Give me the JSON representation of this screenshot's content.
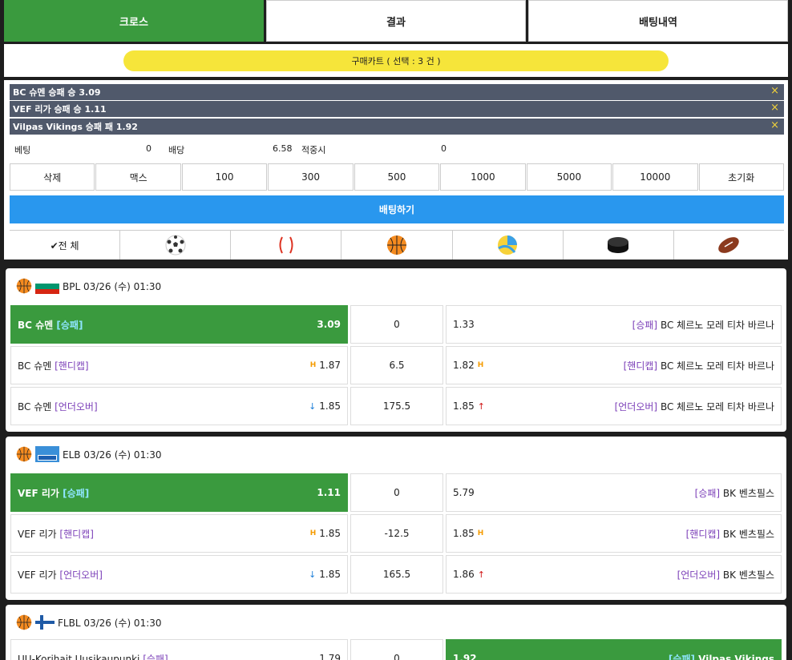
{
  "tabs": [
    "크로스",
    "결과",
    "배팅내역"
  ],
  "cart": {
    "label": "구매카트 ( 선택 : 3 건 )"
  },
  "selections": [
    {
      "text": "BC 슈멘 승패 승 3.09",
      "close": "×"
    },
    {
      "text": "VEF 리가 승패 승 1.11",
      "close": "×"
    },
    {
      "text": "Vilpas Vikings 승패 패 1.92",
      "close": "×"
    }
  ],
  "betinfo": {
    "bet_label": "베팅",
    "bet_value": "0",
    "odds_label": "배당",
    "odds_value": "6.58",
    "win_label": "적중시",
    "win_value": "0"
  },
  "amount_buttons": [
    "삭제",
    "맥스",
    "100",
    "300",
    "500",
    "1000",
    "5000",
    "10000",
    "초기화"
  ],
  "bet_button": "배팅하기",
  "sports": {
    "all_label": "✔전 체",
    "icons": [
      "soccer-ball-icon",
      "baseball-icon",
      "basketball-icon",
      "volleyball-icon",
      "hockey-puck-icon",
      "football-icon"
    ]
  },
  "colors": {
    "green": "#3a9a3e",
    "blue": "#2997ee",
    "cart_yellow": "#f6e53a",
    "slip_bg": "#50596b",
    "tag_purple": "#7b3fb8"
  },
  "games": [
    {
      "league": "BPL 03/26 (수) 01:30",
      "flag": "bulgaria-flag-icon",
      "rows": [
        {
          "home": "BC 슈멘",
          "htag": "[승패]",
          "hmark": "",
          "hodd": "3.09",
          "mid": "0",
          "aodd": "1.33",
          "amark": "",
          "atag": "[승패]",
          "away": "BC 체르노 모레 티차 바르나",
          "win": "home"
        },
        {
          "home": "BC 슈멘",
          "htag": "[핸디캡]",
          "hmark": "H",
          "hodd": "1.87",
          "mid": "6.5",
          "aodd": "1.82",
          "amark": "H",
          "atag": "[핸디캡]",
          "away": "BC 체르노 모레 티차 바르나",
          "win": ""
        },
        {
          "home": "BC 슈멘",
          "htag": "[언더오버]",
          "hmark": "↓",
          "hodd": "1.85",
          "mid": "175.5",
          "aodd": "1.85",
          "amark": "↑",
          "atag": "[언더오버]",
          "away": "BC 체르노 모레 티차 바르나",
          "win": ""
        }
      ]
    },
    {
      "league": "ELB 03/26 (수) 01:30",
      "flag": "euro-flag-icon",
      "rows": [
        {
          "home": "VEF 리가",
          "htag": "[승패]",
          "hmark": "",
          "hodd": "1.11",
          "mid": "0",
          "aodd": "5.79",
          "amark": "",
          "atag": "[승패]",
          "away": "BK 벤츠필스",
          "win": "home"
        },
        {
          "home": "VEF 리가",
          "htag": "[핸디캡]",
          "hmark": "H",
          "hodd": "1.85",
          "mid": "-12.5",
          "aodd": "1.85",
          "amark": "H",
          "atag": "[핸디캡]",
          "away": "BK 벤츠필스",
          "win": ""
        },
        {
          "home": "VEF 리가",
          "htag": "[언더오버]",
          "hmark": "↓",
          "hodd": "1.85",
          "mid": "165.5",
          "aodd": "1.86",
          "amark": "↑",
          "atag": "[언더오버]",
          "away": "BK 벤츠필스",
          "win": ""
        }
      ]
    },
    {
      "league": "FLBL 03/26 (수) 01:30",
      "flag": "finland-flag-icon",
      "rows": [
        {
          "home": "UU-Korihait Uusikaupunki",
          "htag": "[승패]",
          "hmark": "",
          "hodd": "1.79",
          "mid": "0",
          "aodd": "1.92",
          "amark": "",
          "atag": "[승패]",
          "away": "Vilpas Vikings",
          "win": "away"
        }
      ]
    }
  ]
}
